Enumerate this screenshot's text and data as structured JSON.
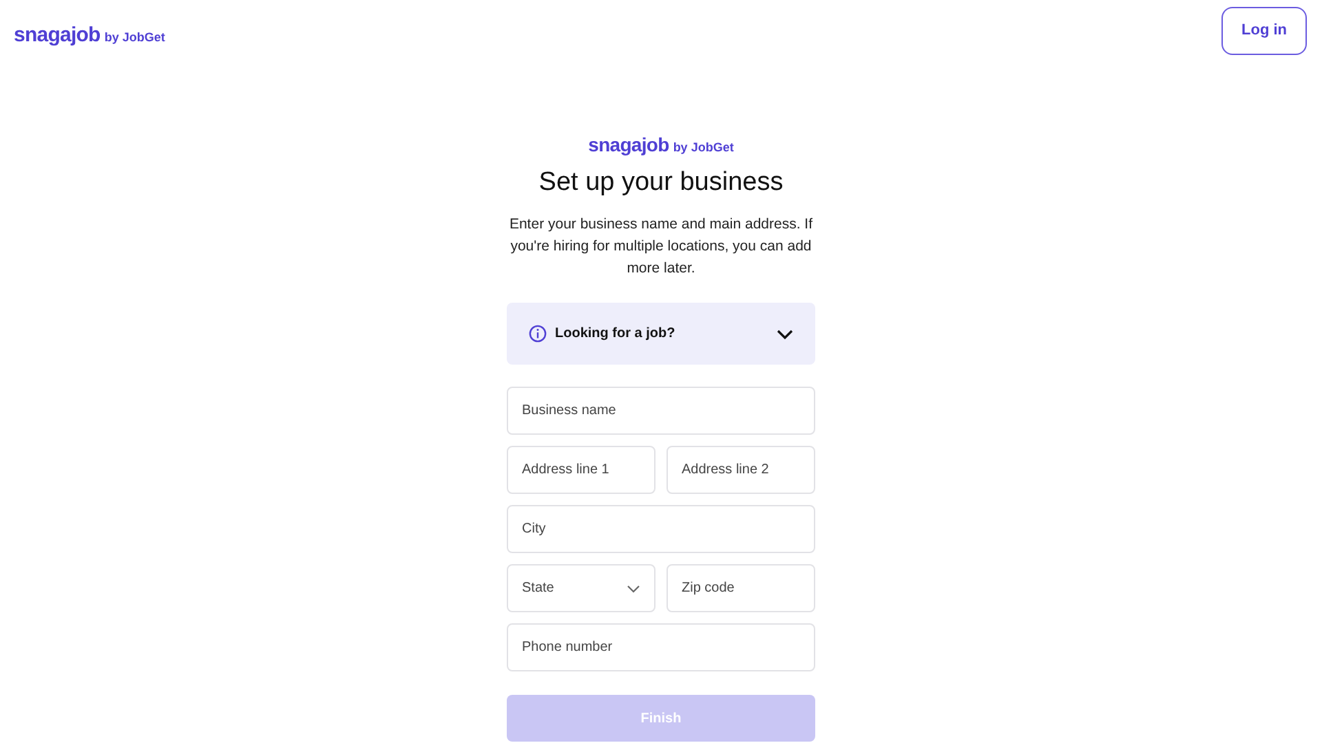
{
  "header": {
    "logo": {
      "brand": "snagajob",
      "suffix": "by JobGet"
    },
    "login_button": "Log in"
  },
  "form": {
    "logo": {
      "brand": "snagajob",
      "suffix": "by JobGet"
    },
    "title": "Set up your business",
    "description": "Enter your business name and main address. If you're hiring for multiple locations, you can add more later.",
    "accordion": {
      "label": "Looking for a job?",
      "expanded": false
    },
    "rows": [
      [
        {
          "kind": "text",
          "placeholder": "Business name"
        }
      ],
      [
        {
          "kind": "text",
          "placeholder": "Address line 1"
        },
        {
          "kind": "text",
          "placeholder": "Address line 2"
        }
      ],
      [
        {
          "kind": "text",
          "placeholder": "City"
        }
      ],
      [
        {
          "kind": "select",
          "placeholder": "State"
        },
        {
          "kind": "text",
          "placeholder": "Zip code"
        }
      ],
      [
        {
          "kind": "text",
          "placeholder": "Phone number"
        }
      ]
    ],
    "submit": {
      "label": "Finish",
      "disabled": true
    }
  }
}
